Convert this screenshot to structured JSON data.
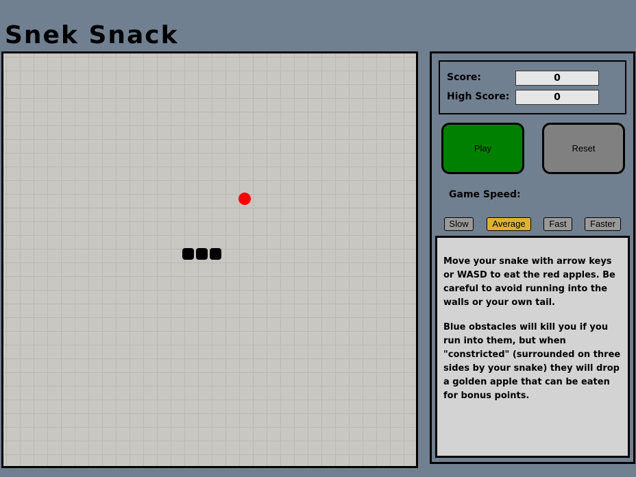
{
  "title": "Snek Snack",
  "game": {
    "snake_segments": 3,
    "apple_color": "#ff0000",
    "snake_color": "#000000",
    "board_color": "#c8c7c2"
  },
  "panel": {
    "score_label": "Score:",
    "score_value": "0",
    "high_score_label": "High Score:",
    "high_score_value": "0",
    "play_label": "Play",
    "reset_label": "Reset",
    "speed_label": "Game Speed:",
    "speeds": [
      "Slow",
      "Average",
      "Fast",
      "Faster"
    ],
    "selected_speed": "Average",
    "instructions_1": "Move your snake with arrow keys or WASD to eat the red apples. Be careful to avoid running into the walls or your own tail.",
    "instructions_2": "Blue obstacles will kill you if you run into them, but when \"constricted\" (surrounded on three sides by your snake) they will drop a golden apple that can be eaten for bonus points."
  },
  "colors": {
    "background": "#708090",
    "play": "#008000",
    "reset": "#808080",
    "speed_active": "#e0b030",
    "speed_inactive": "#999999"
  }
}
